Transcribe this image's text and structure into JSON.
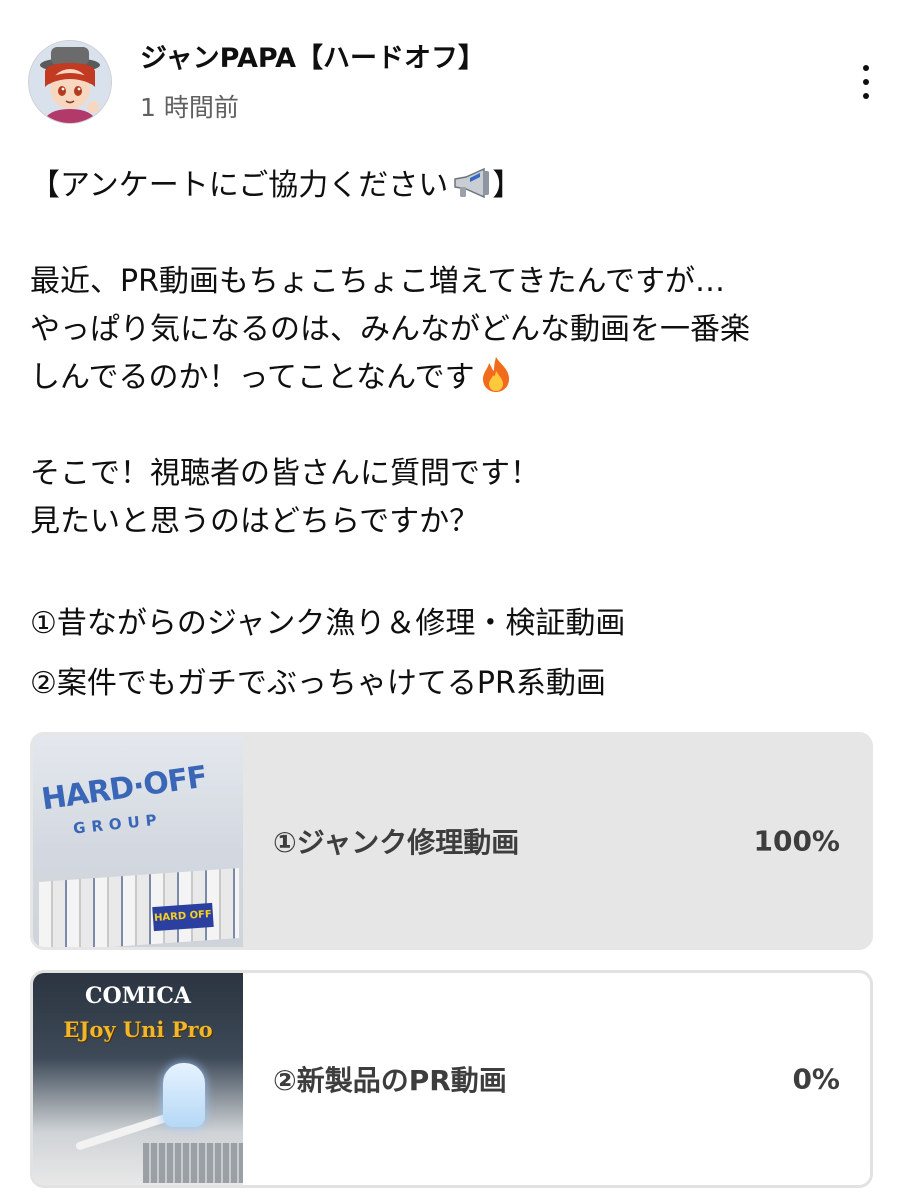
{
  "header": {
    "channel_name": "ジャンPAPA【ハードオフ】",
    "time": "1 時間前",
    "avatar_icon": "avatar",
    "more_icon": "more-vert-icon"
  },
  "body": {
    "line1": "【アンケートにご協力ください",
    "line1_end": "】",
    "line2": "最近、PR動画もちょこちょこ増えてきたんですが…",
    "line3": "やっぱり気になるのは、みんながどんな動画を一番楽",
    "line4": "しんでるのか！ってことなんです",
    "line5": "そこで！視聴者の皆さんに質問です！",
    "line6": "見たいと思うのはどちらですか？",
    "line7": "①昔ながらのジャンク漁り＆修理・検証動画",
    "line8": "②案件でもガチでぶっちゃけてるPR系動画",
    "megaphone_icon": "megaphone-icon",
    "fire_icon": "fire-icon"
  },
  "poll": {
    "options": [
      {
        "label": "①ジャンク修理動画",
        "percent": "100%",
        "value": 100,
        "thumb_text_1": "HARD·OFF",
        "thumb_text_2": "GROUP",
        "selected": true
      },
      {
        "label": "②新製品のPR動画",
        "percent": "0%",
        "value": 0,
        "thumb_text_1": "COMICA",
        "thumb_text_2": "EJoy Uni Pro",
        "selected": false
      }
    ]
  },
  "colors": {
    "text": "#0f0f0f",
    "secondary_text": "#606060",
    "poll_selected_bg": "#e6e6e6",
    "poll_border": "#e2e2e2"
  }
}
